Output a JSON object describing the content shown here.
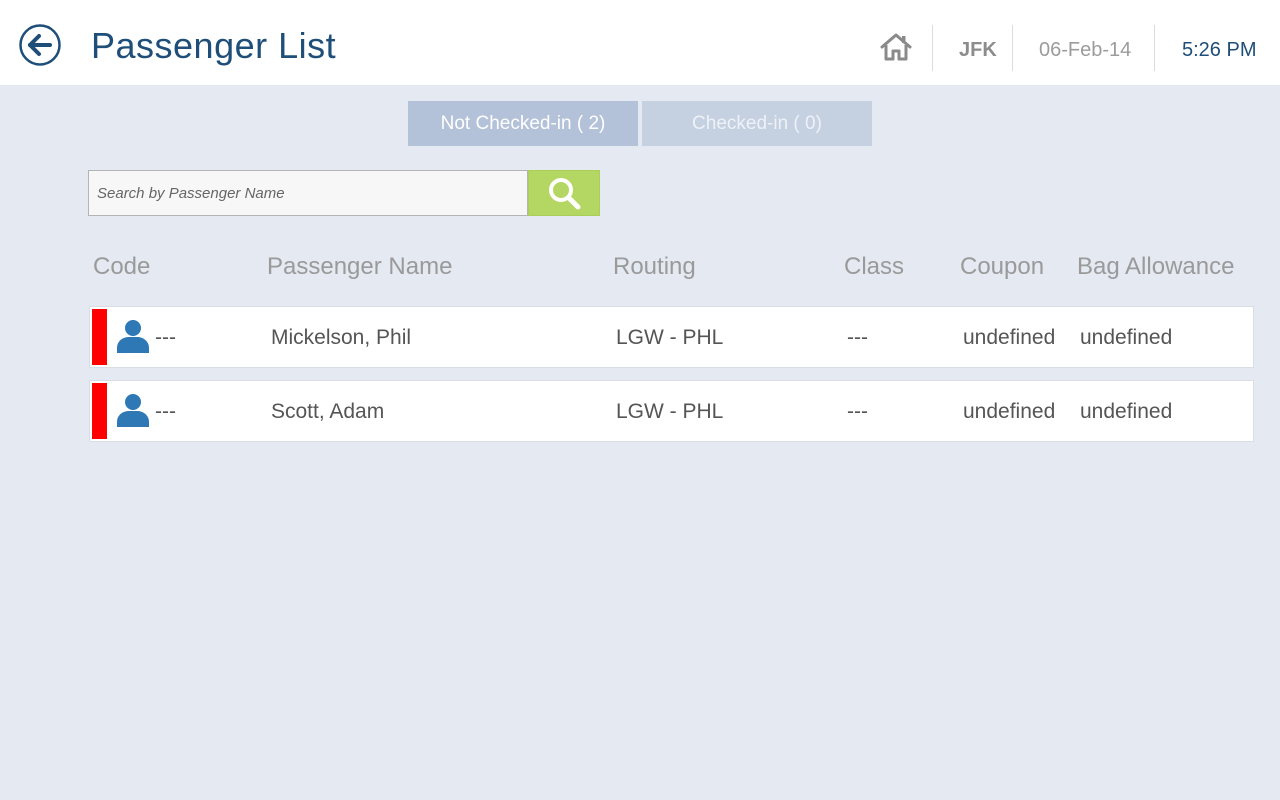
{
  "header": {
    "title": "Passenger List",
    "airport": "JFK",
    "date": "06-Feb-14",
    "time": "5:26 PM"
  },
  "tabs": [
    {
      "label": "Not Checked-in ( 2)",
      "active": true
    },
    {
      "label": "Checked-in ( 0)",
      "active": false
    }
  ],
  "search": {
    "placeholder": "Search by Passenger Name",
    "value": ""
  },
  "table": {
    "columns": [
      "Code",
      "Passenger Name",
      "Routing",
      "Class",
      "Coupon",
      "Bag Allowance"
    ],
    "rows": [
      {
        "code": "---",
        "name": "Mickelson, Phil",
        "routing": "LGW - PHL",
        "class": "---",
        "coupon": "undefined",
        "bag_allowance": "undefined"
      },
      {
        "code": "---",
        "name": "Scott, Adam",
        "routing": "LGW - PHL",
        "class": "---",
        "coupon": "undefined",
        "bag_allowance": "undefined"
      }
    ]
  },
  "icons": {
    "back": "back-arrow-icon",
    "home": "home-icon",
    "search": "search-icon",
    "passenger": "person-icon"
  },
  "colors": {
    "accent": "#1f4e79",
    "search_button": "#b4d763",
    "status_not_checked_in": "#ff0000",
    "person_icon": "#2e78b6"
  }
}
